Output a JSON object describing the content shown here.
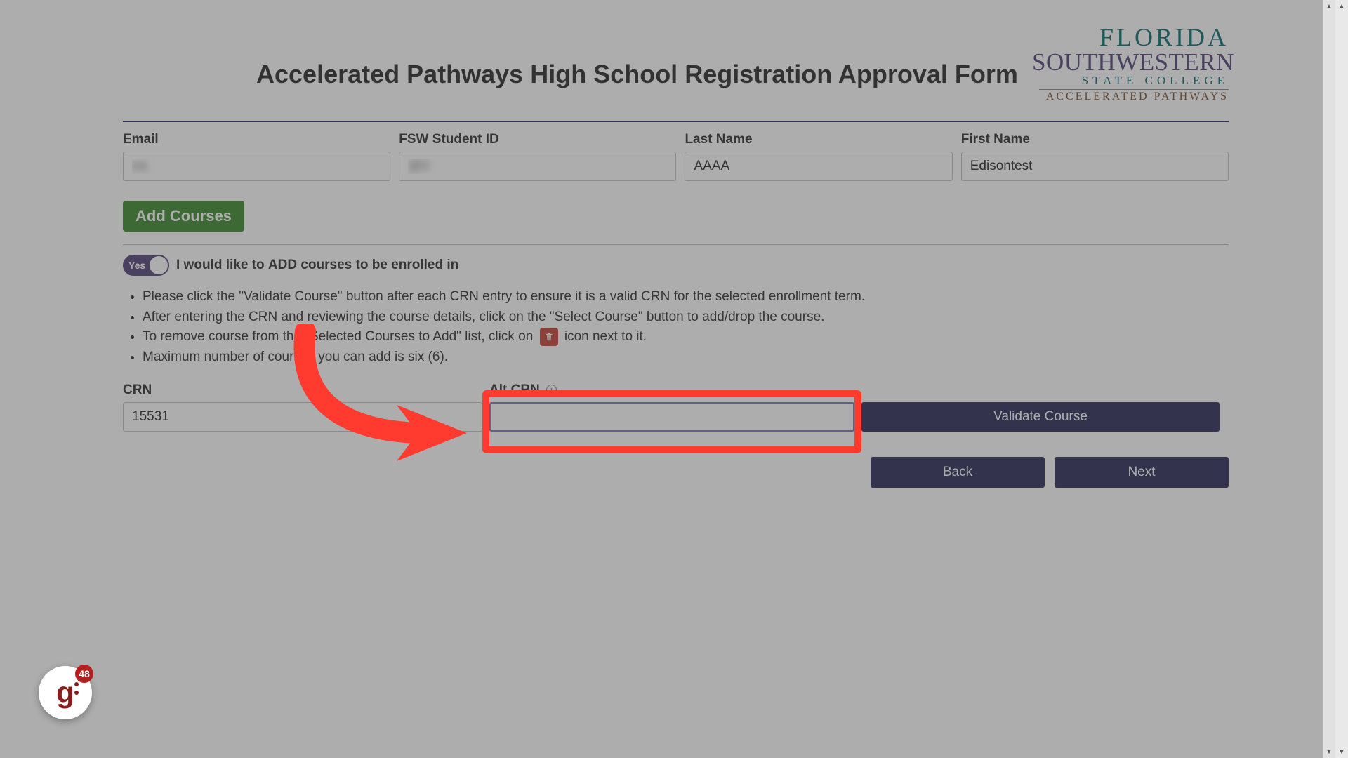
{
  "colors": {
    "navy": "#2e2e5a",
    "green": "#3f8a2f",
    "highlight": "#ff3b2f",
    "trash": "#c44537"
  },
  "logo": {
    "line1": "FLORIDA",
    "line2": "SOUTHWESTERN",
    "line3": "STATE COLLEGE",
    "line4": "ACCELERATED PATHWAYS"
  },
  "title": "Accelerated Pathways High School Registration Approval Form",
  "fields": {
    "email": {
      "label": "Email",
      "value": "ea"
    },
    "fswid": {
      "label": "FSW Student ID",
      "value": "@0"
    },
    "lastname": {
      "label": "Last Name",
      "value": "AAAA"
    },
    "firstname": {
      "label": "First Name",
      "value": "Edisontest"
    }
  },
  "section_add": "Add Courses",
  "toggle": {
    "value": "Yes",
    "prefix": "I would like to ",
    "bold": "ADD",
    "suffix": " courses to be enrolled in"
  },
  "instructions": [
    "Please click the \"Validate Course\" button after each CRN entry to ensure it is a valid CRN for the selected enrollment term.",
    "After entering the CRN and reviewing the course details, click on the \"Select Course\" button to add/drop the course.",
    {
      "pre": "To remove course from the \"Selected Courses to Add\" list, click on ",
      "post": " icon next to it."
    },
    "Maximum number of courses you can add is six (6)."
  ],
  "crn": {
    "label": "CRN",
    "value": "15531"
  },
  "altcrn": {
    "label": "Alt CRN",
    "value": ""
  },
  "buttons": {
    "validate": "Validate Course",
    "back": "Back",
    "next": "Next"
  },
  "fab": {
    "count": "48"
  }
}
